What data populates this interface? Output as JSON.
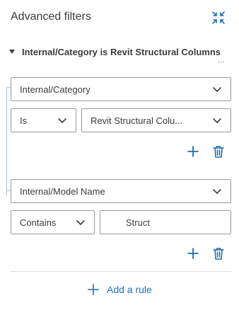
{
  "panel": {
    "title": "Advanced filters",
    "collapse_icon": "collapse-arrows-icon"
  },
  "group": {
    "title": "Internal/Category is Revit Structural Columns",
    "ellipsis": "..."
  },
  "rules": [
    {
      "property": "Internal/Category",
      "operator": "Is",
      "value": "Revit Structural Colu..."
    },
    {
      "property": "Internal/Model Name",
      "operator": "Contains",
      "value": "Struct"
    }
  ],
  "actions": {
    "add_rule_label": "Add a rule"
  },
  "colors": {
    "accent": "#1a6fb5",
    "border": "#9a9a9a",
    "connector": "#a9c7e3"
  }
}
